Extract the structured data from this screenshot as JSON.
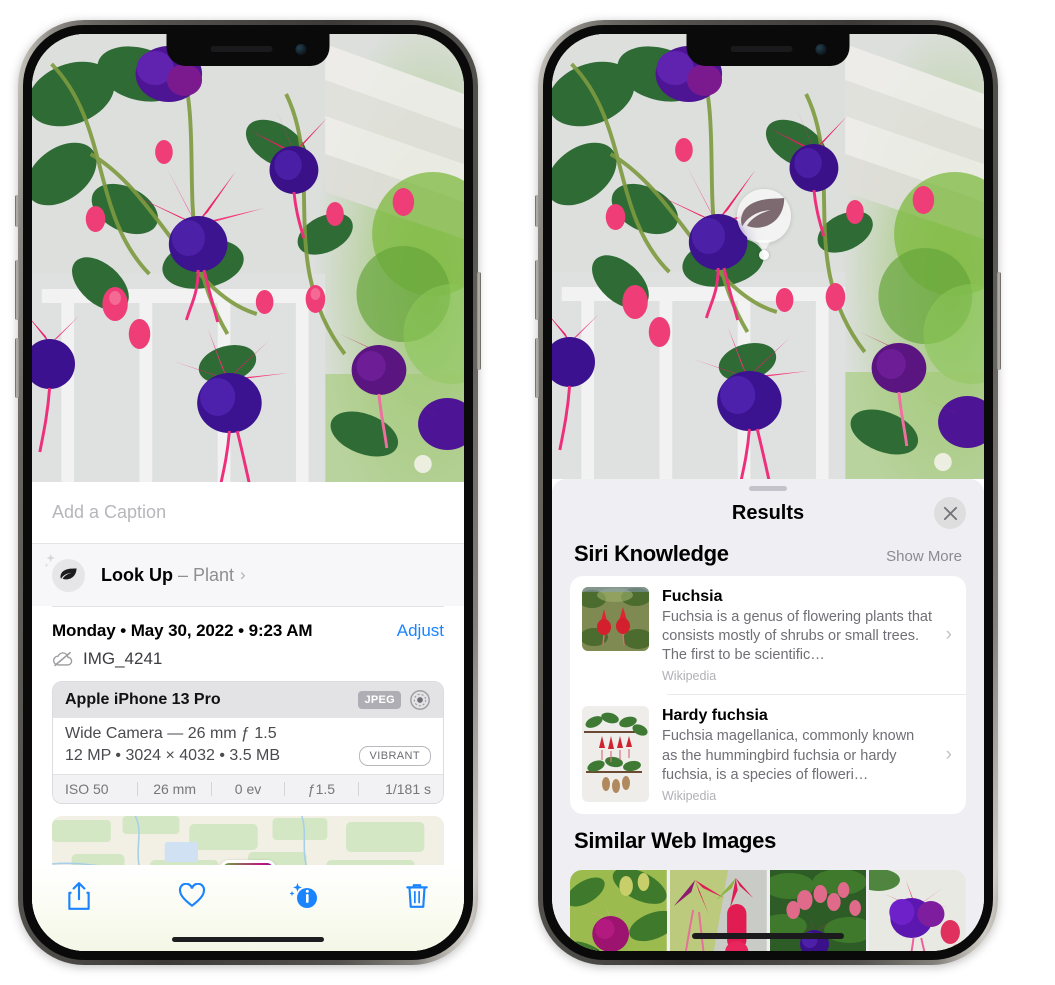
{
  "left_phone": {
    "caption_field": {
      "placeholder": "Add a Caption",
      "value": ""
    },
    "look_up": {
      "label": "Look Up",
      "dash": " – ",
      "subject": "Plant",
      "chevron": "›",
      "icon": "leaf-icon"
    },
    "date_line": "Monday • May 30, 2022 • 9:23 AM",
    "adjust_label": "Adjust",
    "file_name": "IMG_4241",
    "file_icon": "icloud-slash-icon",
    "exif": {
      "device": "Apple iPhone 13 Pro",
      "format_badge": "JPEG",
      "aperture_icon": "aperture-icon",
      "lens_line": "Wide Camera — 26 mm ƒ 1.5",
      "size_line": "12 MP • 3024 × 4032 • 3.5 MB",
      "style_badge": "VIBRANT",
      "settings": [
        "ISO 50",
        "26 mm",
        "0 ev",
        "ƒ1.5",
        "1/181 s"
      ]
    },
    "toolbar": [
      {
        "name": "share-icon",
        "label": "Share"
      },
      {
        "name": "heart-icon",
        "label": "Favorite"
      },
      {
        "name": "info-sparkle-icon",
        "label": "Info"
      },
      {
        "name": "trash-icon",
        "label": "Delete"
      }
    ]
  },
  "right_phone": {
    "visual_lookup_badge": {
      "icon": "leaf-icon"
    },
    "sheet": {
      "title": "Results",
      "close_icon": "close-icon",
      "sections": [
        {
          "title": "Siri Knowledge",
          "action": "Show More",
          "items": [
            {
              "title": "Fuchsia",
              "description": "Fuchsia is a genus of flowering plants that consists mostly of shrubs or small trees. The first to be scientific…",
              "source": "Wikipedia",
              "chevron": "›",
              "thumb": "fuchsia-red-flowers-thumb"
            },
            {
              "title": "Hardy fuchsia",
              "description": "Fuchsia magellanica, commonly known as the hummingbird fuchsia or hardy fuchsia, is a species of floweri…",
              "source": "Wikipedia",
              "chevron": "›",
              "thumb": "hardy-fuchsia-branch-thumb"
            }
          ]
        },
        {
          "title": "Similar Web Images",
          "action": "",
          "images": [
            "fuchsia-web-image-1",
            "fuchsia-web-image-2",
            "fuchsia-web-image-3",
            "fuchsia-web-image-4"
          ]
        }
      ]
    }
  },
  "colors": {
    "accent_blue": "#1a84ff",
    "sheet_bg": "#efeef3",
    "card_white": "#ffffff",
    "secondary_text": "#8e8e93",
    "badge_gray": "#aeaeb4"
  }
}
